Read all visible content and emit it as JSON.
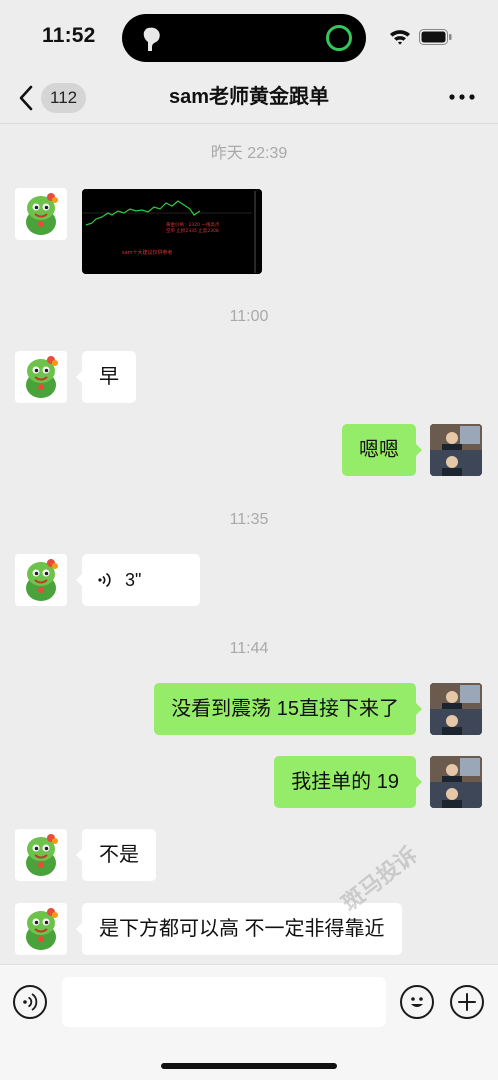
{
  "status_bar": {
    "time": "11:52"
  },
  "nav": {
    "back_count": "112",
    "title": "sam老师黄金跟单"
  },
  "messages": {
    "ts1": "昨天 22:39",
    "image_caption": "sam十大建议仅供参考",
    "ts2": "11:00",
    "m1": "早",
    "m2": "嗯嗯",
    "ts3": "11:35",
    "voice_duration": "3\"",
    "ts4": "11:44",
    "m3": "没看到震荡 15直接下来了",
    "m4": "我挂单的 19",
    "m5": "不是",
    "m6": "是下方都可以高 不一定非得靠近"
  },
  "watermark": "斑马投诉",
  "colors": {
    "sent_bubble": "#95ec69",
    "received_bubble": "#ffffff",
    "background": "#ededed",
    "status_ring": "#34c759"
  },
  "icons": [
    "chevron-left-icon",
    "more-icon",
    "voice-icon",
    "emoji-icon",
    "plus-icon",
    "wifi-icon",
    "battery-icon",
    "earbud-icon"
  ]
}
